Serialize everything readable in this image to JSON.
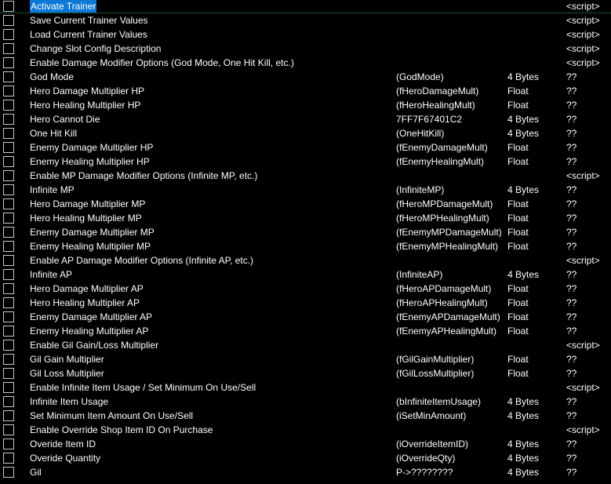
{
  "colors": {
    "background": "#000000",
    "text": "#ffffff",
    "selection": "#0b78d7",
    "selected_row_border": "#3a9b55"
  },
  "rows": [
    {
      "desc": "Activate Trainer",
      "addr": "",
      "type": "",
      "value": "<script>",
      "selected": true
    },
    {
      "desc": "Save Current Trainer Values",
      "addr": "",
      "type": "",
      "value": "<script>"
    },
    {
      "desc": "Load Current Trainer Values",
      "addr": "",
      "type": "",
      "value": "<script>"
    },
    {
      "desc": "Change Slot Config Description",
      "addr": "",
      "type": "",
      "value": "<script>"
    },
    {
      "desc": "Enable Damage Modifier Options (God Mode, One Hit Kill, etc.)",
      "addr": "",
      "type": "",
      "value": "<script>"
    },
    {
      "desc": "God Mode",
      "addr": "(GodMode)",
      "type": "4 Bytes",
      "value": "??"
    },
    {
      "desc": "Hero Damage Multiplier HP",
      "addr": "(fHeroDamageMult)",
      "type": "Float",
      "value": "??"
    },
    {
      "desc": "Hero Healing Multiplier HP",
      "addr": "(fHeroHealingMult)",
      "type": "Float",
      "value": "??"
    },
    {
      "desc": "Hero Cannot Die",
      "addr": "7FF7F67401C2",
      "type": "4 Bytes",
      "value": "??"
    },
    {
      "desc": "One Hit Kill",
      "addr": "(OneHitKill)",
      "type": "4 Bytes",
      "value": "??"
    },
    {
      "desc": "Enemy Damage Multiplier HP",
      "addr": "(fEnemyDamageMult)",
      "type": "Float",
      "value": "??"
    },
    {
      "desc": "Enemy Healing Multiplier HP",
      "addr": "(fEnemyHealingMult)",
      "type": "Float",
      "value": "??"
    },
    {
      "desc": "Enable MP Damage Modifier Options (Infinite MP, etc.)",
      "addr": "",
      "type": "",
      "value": "<script>"
    },
    {
      "desc": "Infinite MP",
      "addr": "(InfiniteMP)",
      "type": "4 Bytes",
      "value": "??"
    },
    {
      "desc": "Hero Damage Multiplier MP",
      "addr": "(fHeroMPDamageMult)",
      "type": "Float",
      "value": "??"
    },
    {
      "desc": "Hero Healing Multiplier MP",
      "addr": "(fHeroMPHealingMult)",
      "type": "Float",
      "value": "??"
    },
    {
      "desc": "Enemy Damage Multiplier MP",
      "addr": "(fEnemyMPDamageMult)",
      "type": "Float",
      "value": "??"
    },
    {
      "desc": "Enemy Healing Multiplier MP",
      "addr": "(fEnemyMPHealingMult)",
      "type": "Float",
      "value": "??"
    },
    {
      "desc": "Enable AP Damage Modifier Options (Infinite AP, etc.)",
      "addr": "",
      "type": "",
      "value": "<script>"
    },
    {
      "desc": "Infinite AP",
      "addr": "(InfiniteAP)",
      "type": "4 Bytes",
      "value": "??"
    },
    {
      "desc": "Hero Damage Multiplier AP",
      "addr": "(fHeroAPDamageMult)",
      "type": "Float",
      "value": "??"
    },
    {
      "desc": "Hero Healing Multiplier AP",
      "addr": "(fHeroAPHealingMult)",
      "type": "Float",
      "value": "??"
    },
    {
      "desc": "Enemy Damage Multiplier AP",
      "addr": "(fEnemyAPDamageMult)",
      "type": "Float",
      "value": "??"
    },
    {
      "desc": "Enemy Healing Multiplier AP",
      "addr": "(fEnemyAPHealingMult)",
      "type": "Float",
      "value": "??"
    },
    {
      "desc": "Enable Gil Gain/Loss Multiplier",
      "addr": "",
      "type": "",
      "value": "<script>"
    },
    {
      "desc": "Gil Gain Multiplier",
      "addr": "(fGilGainMultiplier)",
      "type": "Float",
      "value": "??"
    },
    {
      "desc": "Gil Loss Multiplier",
      "addr": "(fGilLossMultiplier)",
      "type": "Float",
      "value": "??"
    },
    {
      "desc": "Enable Infinite Item Usage / Set Minimum On Use/Sell",
      "addr": "",
      "type": "",
      "value": "<script>"
    },
    {
      "desc": "Infinite Item Usage",
      "addr": "(bInfiniteItemUsage)",
      "type": "4 Bytes",
      "value": "??"
    },
    {
      "desc": "Set Minimum Item Amount On Use/Sell",
      "addr": "(iSetMinAmount)",
      "type": "4 Bytes",
      "value": "??"
    },
    {
      "desc": "Enable Override Shop Item ID On Purchase",
      "addr": "",
      "type": "",
      "value": "<script>"
    },
    {
      "desc": "Overide Item ID",
      "addr": "(iOverrideItemID)",
      "type": "4 Bytes",
      "value": "??"
    },
    {
      "desc": "Overide Quantity",
      "addr": "(iOverrideQty)",
      "type": "4 Bytes",
      "value": "??"
    },
    {
      "desc": "Gil",
      "addr": "P->????????",
      "type": "4 Bytes",
      "value": "??"
    }
  ]
}
